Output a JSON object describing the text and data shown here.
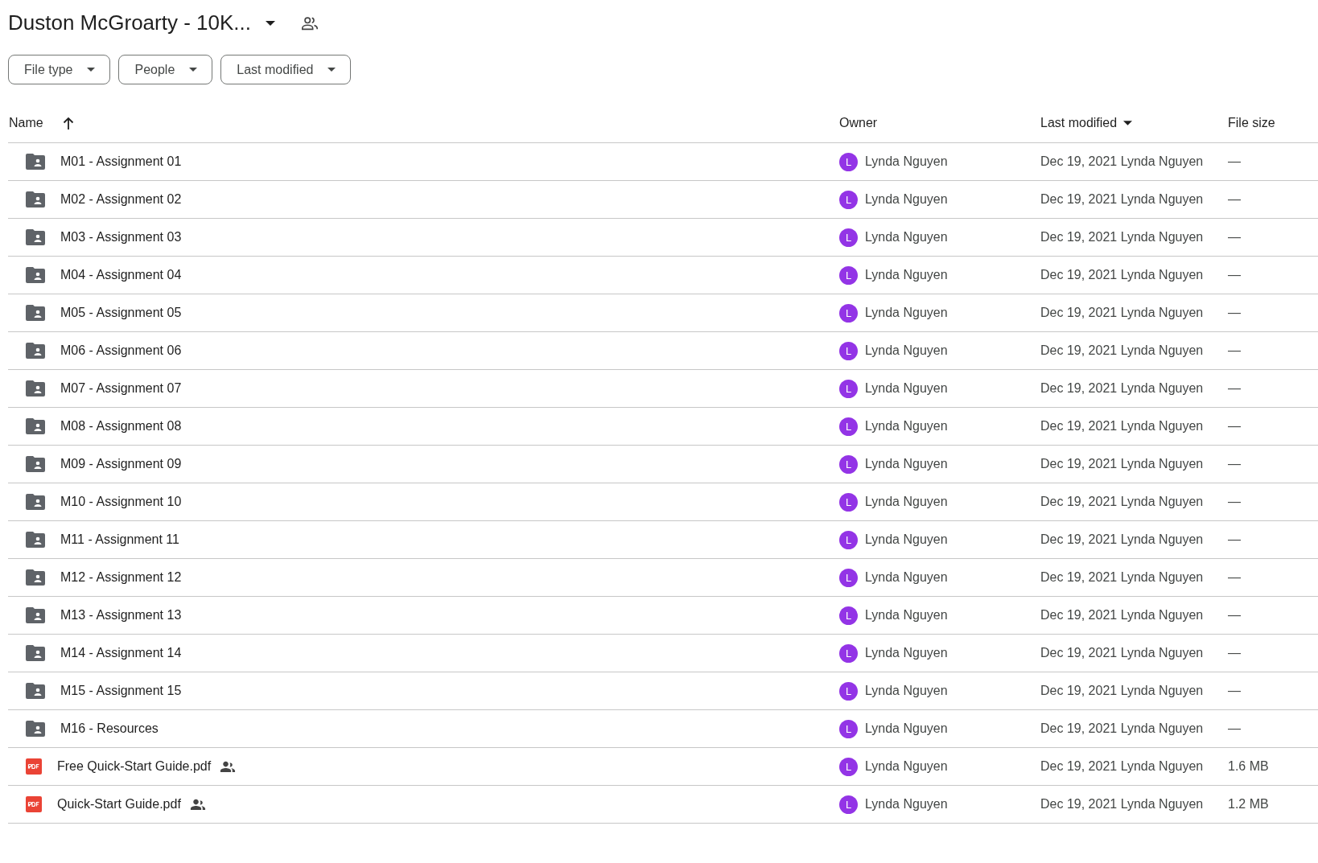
{
  "title": "Duston McGroarty - 10K...",
  "filters": [
    "File type",
    "People",
    "Last modified"
  ],
  "columns": [
    {
      "label": "Name",
      "sorted": true,
      "ascending": true
    },
    {
      "label": "Owner",
      "sorted": false
    },
    {
      "label": "Last modified",
      "sorted": true,
      "ascending": false
    },
    {
      "label": "File size",
      "sorted": false
    }
  ],
  "rows": [
    {
      "kind": "folder",
      "name": "M01 - Assignment 01",
      "shared": false,
      "avatar": "L",
      "color": "#9334e6",
      "owner": "Lynda Nguyen",
      "modified": "Dec 19, 2021 Lynda Nguyen",
      "size": "—"
    },
    {
      "kind": "folder",
      "name": "M02 - Assignment 02",
      "shared": false,
      "avatar": "L",
      "color": "#9334e6",
      "owner": "Lynda Nguyen",
      "modified": "Dec 19, 2021 Lynda Nguyen",
      "size": "—"
    },
    {
      "kind": "folder",
      "name": "M03 - Assignment 03",
      "shared": false,
      "avatar": "L",
      "color": "#9334e6",
      "owner": "Lynda Nguyen",
      "modified": "Dec 19, 2021 Lynda Nguyen",
      "size": "—"
    },
    {
      "kind": "folder",
      "name": "M04 - Assignment 04",
      "shared": false,
      "avatar": "L",
      "color": "#9334e6",
      "owner": "Lynda Nguyen",
      "modified": "Dec 19, 2021 Lynda Nguyen",
      "size": "—"
    },
    {
      "kind": "folder",
      "name": "M05 - Assignment 05",
      "shared": false,
      "avatar": "L",
      "color": "#9334e6",
      "owner": "Lynda Nguyen",
      "modified": "Dec 19, 2021 Lynda Nguyen",
      "size": "—"
    },
    {
      "kind": "folder",
      "name": "M06 - Assignment 06",
      "shared": false,
      "avatar": "L",
      "color": "#9334e6",
      "owner": "Lynda Nguyen",
      "modified": "Dec 19, 2021 Lynda Nguyen",
      "size": "—"
    },
    {
      "kind": "folder",
      "name": "M07 - Assignment 07",
      "shared": false,
      "avatar": "L",
      "color": "#9334e6",
      "owner": "Lynda Nguyen",
      "modified": "Dec 19, 2021 Lynda Nguyen",
      "size": "—"
    },
    {
      "kind": "folder",
      "name": "M08 - Assignment 08",
      "shared": false,
      "avatar": "L",
      "color": "#9334e6",
      "owner": "Lynda Nguyen",
      "modified": "Dec 19, 2021 Lynda Nguyen",
      "size": "—"
    },
    {
      "kind": "folder",
      "name": "M09 - Assignment 09",
      "shared": false,
      "avatar": "L",
      "color": "#9334e6",
      "owner": "Lynda Nguyen",
      "modified": "Dec 19, 2021 Lynda Nguyen",
      "size": "—"
    },
    {
      "kind": "folder",
      "name": "M10 - Assignment 10",
      "shared": false,
      "avatar": "L",
      "color": "#9334e6",
      "owner": "Lynda Nguyen",
      "modified": "Dec 19, 2021 Lynda Nguyen",
      "size": "—"
    },
    {
      "kind": "folder",
      "name": "M11 - Assignment 11",
      "shared": false,
      "avatar": "L",
      "color": "#9334e6",
      "owner": "Lynda Nguyen",
      "modified": "Dec 19, 2021 Lynda Nguyen",
      "size": "—"
    },
    {
      "kind": "folder",
      "name": "M12 - Assignment 12",
      "shared": false,
      "avatar": "L",
      "color": "#9334e6",
      "owner": "Lynda Nguyen",
      "modified": "Dec 19, 2021 Lynda Nguyen",
      "size": "—"
    },
    {
      "kind": "folder",
      "name": "M13 - Assignment 13",
      "shared": false,
      "avatar": "L",
      "color": "#9334e6",
      "owner": "Lynda Nguyen",
      "modified": "Dec 19, 2021 Lynda Nguyen",
      "size": "—"
    },
    {
      "kind": "folder",
      "name": "M14 - Assignment 14",
      "shared": false,
      "avatar": "L",
      "color": "#9334e6",
      "owner": "Lynda Nguyen",
      "modified": "Dec 19, 2021 Lynda Nguyen",
      "size": "—"
    },
    {
      "kind": "folder",
      "name": "M15 - Assignment 15",
      "shared": false,
      "avatar": "L",
      "color": "#9334e6",
      "owner": "Lynda Nguyen",
      "modified": "Dec 19, 2021 Lynda Nguyen",
      "size": "—"
    },
    {
      "kind": "folder",
      "name": "M16 - Resources",
      "shared": false,
      "avatar": "L",
      "color": "#9334e6",
      "owner": "Lynda Nguyen",
      "modified": "Dec 19, 2021 Lynda Nguyen",
      "size": "—"
    },
    {
      "kind": "pdf",
      "name": "Free Quick-Start Guide.pdf",
      "shared": true,
      "avatar": "L",
      "color": "#9334e6",
      "owner": "Lynda Nguyen",
      "modified": "Dec 19, 2021 Lynda Nguyen",
      "size": "1.6 MB"
    },
    {
      "kind": "pdf",
      "name": "Quick-Start Guide.pdf",
      "shared": true,
      "avatar": "L",
      "color": "#9334e6",
      "owner": "Lynda Nguyen",
      "modified": "Dec 19, 2021 Lynda Nguyen",
      "size": "1.2 MB"
    }
  ]
}
